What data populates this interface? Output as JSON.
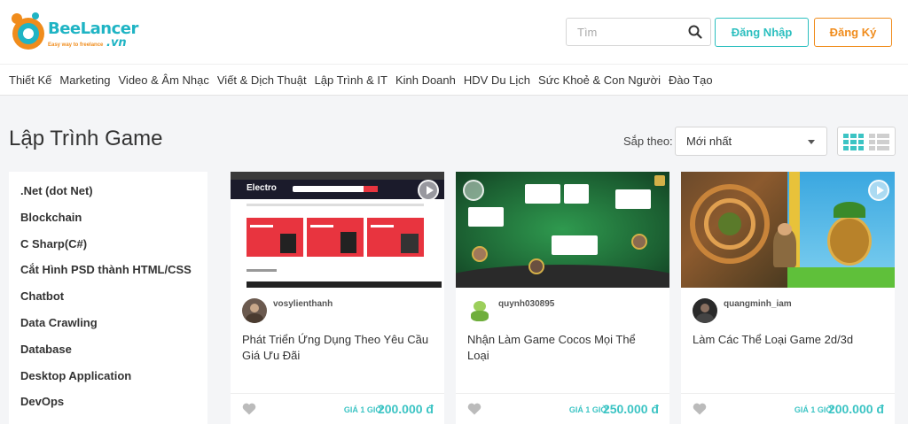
{
  "header": {
    "logo_text": "BeeLancer",
    "logo_suffix": ".vn",
    "logo_tagline": "Easy way to freelance",
    "search_placeholder": "Tìm",
    "login_label": "Đăng Nhập",
    "register_label": "Đăng Ký"
  },
  "nav": [
    "Thiết Kế",
    "Marketing",
    "Video & Âm Nhạc",
    "Viết & Dịch Thuật",
    "Lập Trình & IT",
    "Kinh Doanh",
    "HDV Du Lịch",
    "Sức Khoẻ & Con Người",
    "Đào Tạo"
  ],
  "page": {
    "title": "Lập Trình Game",
    "sort_label": "Sắp theo:",
    "sort_value": "Mới nhất"
  },
  "sidebar": {
    "items": [
      ".Net (dot Net)",
      "Blockchain",
      "C Sharp(C#)",
      "Cắt Hình PSD thành HTML/CSS",
      "Chatbot",
      "Data Crawling",
      "Database",
      "Desktop Application",
      "DevOps"
    ]
  },
  "cards": [
    {
      "seller": "vosylienthanh",
      "title": "Phát Triển Ứng Dụng Theo Yêu Cầu Giá Ưu Đãi",
      "price_label": "GIÁ 1 GIỜ",
      "price": "200.000 đ",
      "thumb_brand": "Electro"
    },
    {
      "seller": "quynh030895",
      "title": "Nhận Làm Game Cocos Mọi Thể Loại",
      "price_label": "GIÁ 1 GIỜ",
      "price": "250.000 đ"
    },
    {
      "seller": "quangminh_iam",
      "title": "Làm Các Thể Loại Game 2d/3d",
      "price_label": "GIÁ 1 GIỜ",
      "price": "200.000 đ"
    }
  ],
  "colors": {
    "accent": "#3cc4c4",
    "orange": "#f08c1c"
  }
}
